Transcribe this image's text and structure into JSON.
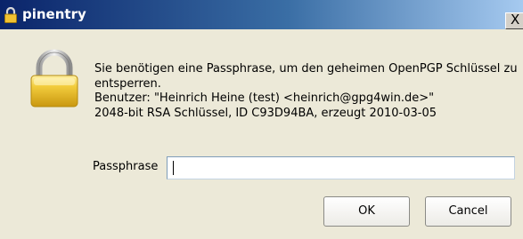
{
  "window": {
    "title": "pinentry",
    "close_glyph": "X"
  },
  "icons": {
    "title_icon": "lock-icon",
    "main_icon": "padlock-icon",
    "close_icon": "close-icon"
  },
  "message": {
    "line1": "Sie benötigen eine Passphrase, um den geheimen OpenPGP Schlüssel zu",
    "line2": "entsperren.",
    "line3": "Benutzer: \"Heinrich Heine (test) <heinrich@gpg4win.de>\"",
    "line4": "2048-bit RSA Schlüssel, ID C93D94BA, erzeugt 2010-03-05"
  },
  "form": {
    "passphrase_label": "Passphrase",
    "passphrase_value": ""
  },
  "buttons": {
    "ok": "OK",
    "cancel": "Cancel"
  },
  "colors": {
    "titlebar_start": "#0a246a",
    "titlebar_end": "#a6caf0",
    "window_bg": "#ece9d8",
    "lock_gold": "#e8c23a"
  }
}
